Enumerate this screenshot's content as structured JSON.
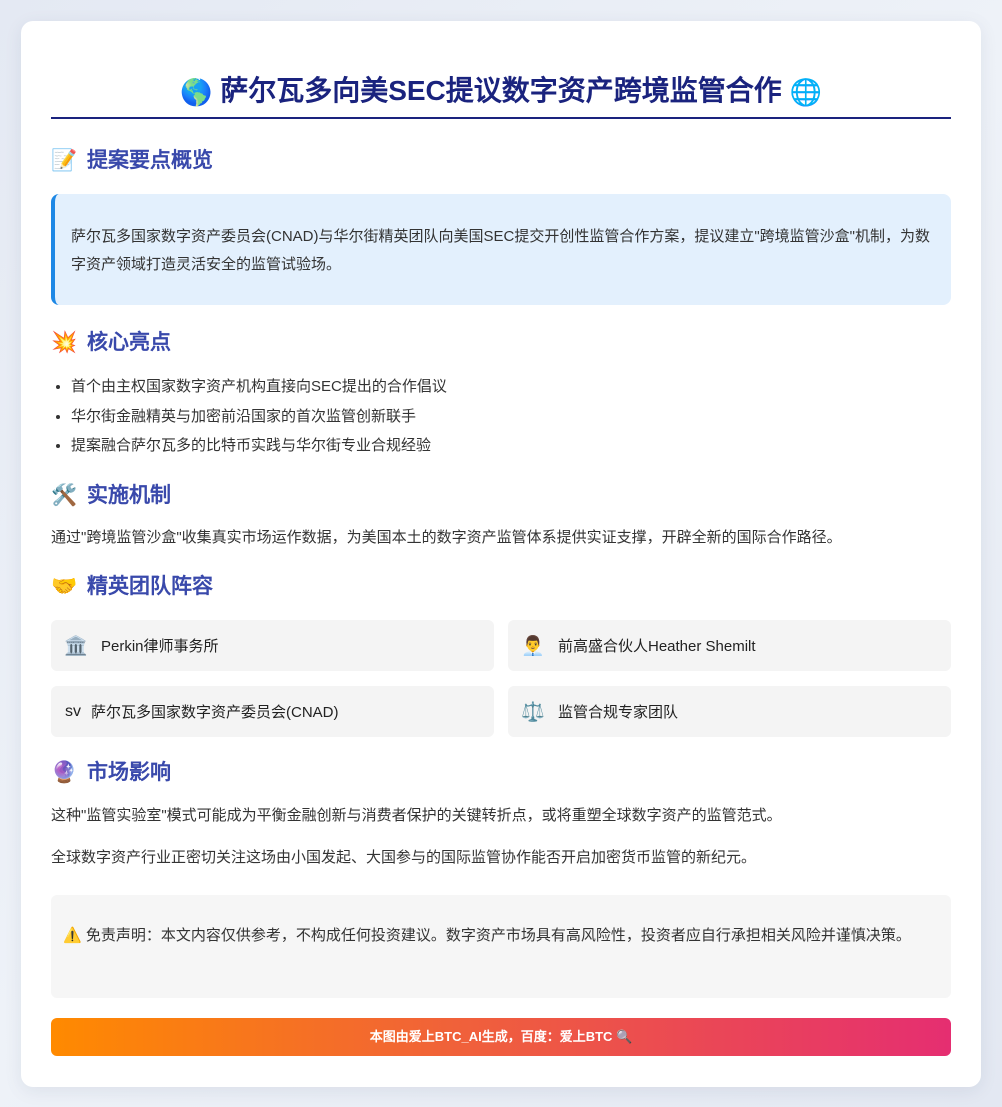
{
  "title": {
    "icon_left": "🌎",
    "text": "萨尔瓦多向美SEC提议数字资产跨境监管合作",
    "icon_right": "🌐"
  },
  "sections": {
    "overview": {
      "icon": "📝",
      "heading": "提案要点概览",
      "body": "萨尔瓦多国家数字资产委员会(CNAD)与华尔街精英团队向美国SEC提交开创性监管合作方案，提议建立\"跨境监管沙盒\"机制，为数字资产领域打造灵活安全的监管试验场。"
    },
    "highlights": {
      "icon": "💥",
      "heading": "核心亮点",
      "items": [
        "首个由主权国家数字资产机构直接向SEC提出的合作倡议",
        "华尔街金融精英与加密前沿国家的首次监管创新联手",
        "提案融合萨尔瓦多的比特币实践与华尔街专业合规经验"
      ]
    },
    "mechanism": {
      "icon": "🛠️",
      "heading": "实施机制",
      "body": "通过\"跨境监管沙盒\"收集真实市场运作数据，为美国本土的数字资产监管体系提供实证支撑，开辟全新的国际合作路径。"
    },
    "team": {
      "icon": "🤝",
      "heading": "精英团队阵容",
      "members": [
        {
          "icon": "🏛️",
          "label": "Perkin律师事务所"
        },
        {
          "icon": "👨‍💼",
          "label": "前高盛合伙人Heather Shemilt"
        },
        {
          "icon": "sv",
          "label": "萨尔瓦多国家数字资产委员会(CNAD)"
        },
        {
          "icon": "⚖️",
          "label": "监管合规专家团队"
        }
      ]
    },
    "impact": {
      "icon": "🔮",
      "heading": "市场影响",
      "paragraphs": [
        "这种\"监管实验室\"模式可能成为平衡金融创新与消费者保护的关键转折点，或将重塑全球数字资产的监管范式。",
        "全球数字资产行业正密切关注这场由小国发起、大国参与的国际监管协作能否开启加密货币监管的新纪元。"
      ]
    }
  },
  "disclaimer": {
    "icon": "⚠️",
    "text": "免责声明：本文内容仅供参考，不构成任何投资建议。数字资产市场具有高风险性，投资者应自行承担相关风险并谨慎决策。"
  },
  "footer": {
    "text": "本图由爱上BTC_AI生成，百度：爱上BTC",
    "icon": "🔍"
  }
}
